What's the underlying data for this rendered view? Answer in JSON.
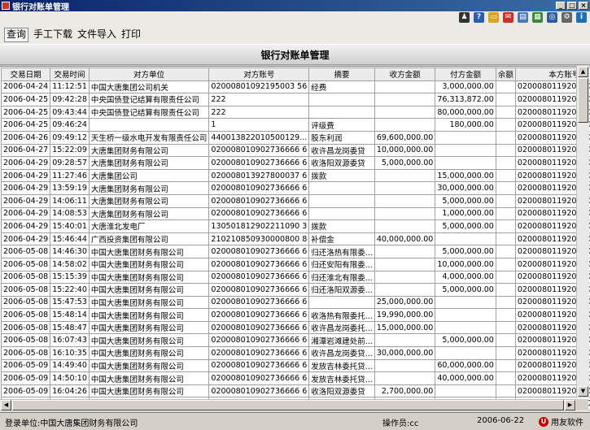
{
  "window": {
    "title": "银行对账单管理"
  },
  "menu": [
    "查询",
    "手工下载",
    "文件导入",
    "打印"
  ],
  "page_title": "银行对账单管理",
  "columns": [
    "交易日期",
    "交易时间",
    "对方单位",
    "对方账号",
    "摘要",
    "收方金额",
    "付方金额",
    "余额",
    "本方账号"
  ],
  "rows": [
    [
      "2006-04-24",
      "11:12:51",
      "中国大唐集团公司机关",
      "02000801092195003 56",
      "经费",
      "",
      "3,000,000.00",
      "",
      "0200080119201003350"
    ],
    [
      "2006-04-25",
      "09:42:28",
      "中央国债登记结算有限责任公司",
      "222",
      "",
      "",
      "76,313,872.00",
      "",
      "0200080119201003350"
    ],
    [
      "2006-04-25",
      "09:43:44",
      "中央国债登记结算有限责任公司",
      "222",
      "",
      "",
      "80,000,000.00",
      "",
      "0200080119201003350"
    ],
    [
      "2006-04-25",
      "09:46:24",
      "",
      "1",
      "评级费",
      "",
      "180,000.00",
      "",
      "0200080119201003350"
    ],
    [
      "2006-04-26",
      "09:49:12",
      "天生桥一级水电开发有限责任公司",
      "440013822010500129...",
      "股东利润",
      "69,600,000.00",
      "",
      "",
      "0200080119201003350"
    ],
    [
      "2006-04-27",
      "15:22:09",
      "大唐集团财务有限公司",
      "020008010902736666 6",
      "收许昌龙岗委贷",
      "10,000,000.00",
      "",
      "",
      "0200080119201003350"
    ],
    [
      "2006-04-29",
      "09:28:57",
      "大唐集团财务有限公司",
      "020008010902736666 6",
      "收洛阳双源委贷",
      "5,000,000.00",
      "",
      "",
      "0200080119201003350"
    ],
    [
      "2006-04-29",
      "11:27:46",
      "大唐集团公司",
      "020008013927800037 6",
      "拨款",
      "",
      "15,000,000.00",
      "",
      "0200080119201003350"
    ],
    [
      "2006-04-29",
      "13:59:19",
      "大唐集团财务有限公司",
      "020008010902736666 6",
      "",
      "",
      "30,000,000.00",
      "",
      "0200080119201003350"
    ],
    [
      "2006-04-29",
      "14:06:11",
      "大唐集团财务有限公司",
      "020008010902736666 6",
      "",
      "",
      "5,000,000.00",
      "",
      "0200080119201003350"
    ],
    [
      "2006-04-29",
      "14:08:53",
      "大唐集团财务有限公司",
      "020008010902736666 6",
      "",
      "",
      "1,000,000.00",
      "",
      "0200080119201003350"
    ],
    [
      "2006-04-29",
      "15:40:01",
      "大唐淮北发电厂",
      "130501812902211090 3",
      "拨款",
      "",
      "5,000,000.00",
      "",
      "0200080119201003350"
    ],
    [
      "2006-04-29",
      "15:46:44",
      "广西投资集团有限公司",
      "210210850930000800 8",
      "补偿金",
      "40,000,000.00",
      "",
      "",
      "0200080119201003350"
    ],
    [
      "2006-05-08",
      "14:46:30",
      "中国大唐集团财务有限公司",
      "020008010902736666 6",
      "归还洛热有限委...",
      "",
      "5,000,000.00",
      "",
      "0200080119201003350"
    ],
    [
      "2006-05-08",
      "14:58:02",
      "中国大唐集团财务有限公司",
      "020008010902736666 6",
      "归还安阳有限委...",
      "",
      "10,000,000.00",
      "",
      "0200080119201003350"
    ],
    [
      "2006-05-08",
      "15:15:39",
      "中国大唐集团财务有限公司",
      "020008010902736666 6",
      "归还淮北有限委...",
      "",
      "4,000,000.00",
      "",
      "0200080119201003350"
    ],
    [
      "2006-05-08",
      "15:22:40",
      "中国大唐集团财务有限公司",
      "020008010902736666 6",
      "归还洛阳双源委...",
      "",
      "5,000,000.00",
      "",
      "0200080119201003350"
    ],
    [
      "2006-05-08",
      "15:47:53",
      "中国大唐集团财务有限公司",
      "020008010902736666 6",
      "",
      "25,000,000.00",
      "",
      "",
      "0200080119201003350"
    ],
    [
      "2006-05-08",
      "15:48:14",
      "中国大唐集团财务有限公司",
      "020008010902736666 6",
      "收洛热有限委托...",
      "19,990,000.00",
      "",
      "",
      "0200080119201003350"
    ],
    [
      "2006-05-08",
      "15:48:47",
      "中国大唐集团财务有限公司",
      "020008010902736666 6",
      "收许昌龙岗委托...",
      "15,000,000.00",
      "",
      "",
      "0200080119201003350"
    ],
    [
      "2006-05-08",
      "16:07:43",
      "中国大唐集团财务有限公司",
      "020008010902736666 6",
      "湘潭岩滩建处前...",
      "",
      "5,000,000.00",
      "",
      "0200080119201003350"
    ],
    [
      "2006-05-08",
      "16:10:35",
      "中国大唐集团财务有限公司",
      "020008010902736666 6",
      "收许昌龙岗委贷...",
      "30,000,000.00",
      "",
      "",
      "0200080119201003350"
    ],
    [
      "2006-05-09",
      "14:49:40",
      "中国大唐集团财务有限公司",
      "020008010902736666 6",
      "发放吉林委托贷...",
      "",
      "60,000,000.00",
      "",
      "0200080119201003350"
    ],
    [
      "2006-05-09",
      "14:50:10",
      "中国大唐集团财务有限公司",
      "020008010902736666 6",
      "发放吉林委托贷...",
      "",
      "40,000,000.00",
      "",
      "0200080119201003350"
    ],
    [
      "2006-05-09",
      "16:04:26",
      "中国大唐集团财务有限公司",
      "020008010902736666 6",
      "收洛阳双源委贷",
      "2,700,000.00",
      "",
      "",
      "0200080119201003350"
    ],
    [
      "2006-05-10",
      "09:14:46",
      "中国大唐集团财务有限公司",
      "020008010902736666 6",
      "归还洛阳热电有...",
      "",
      "5,000,000.00",
      "",
      "0200080119201003350"
    ]
  ],
  "status": {
    "unit_label": "登录单位:中国大唐集团财务有限公司",
    "operator_label": "操作员:cc",
    "date": "2006-06-22",
    "logo_text": "用友软件"
  }
}
